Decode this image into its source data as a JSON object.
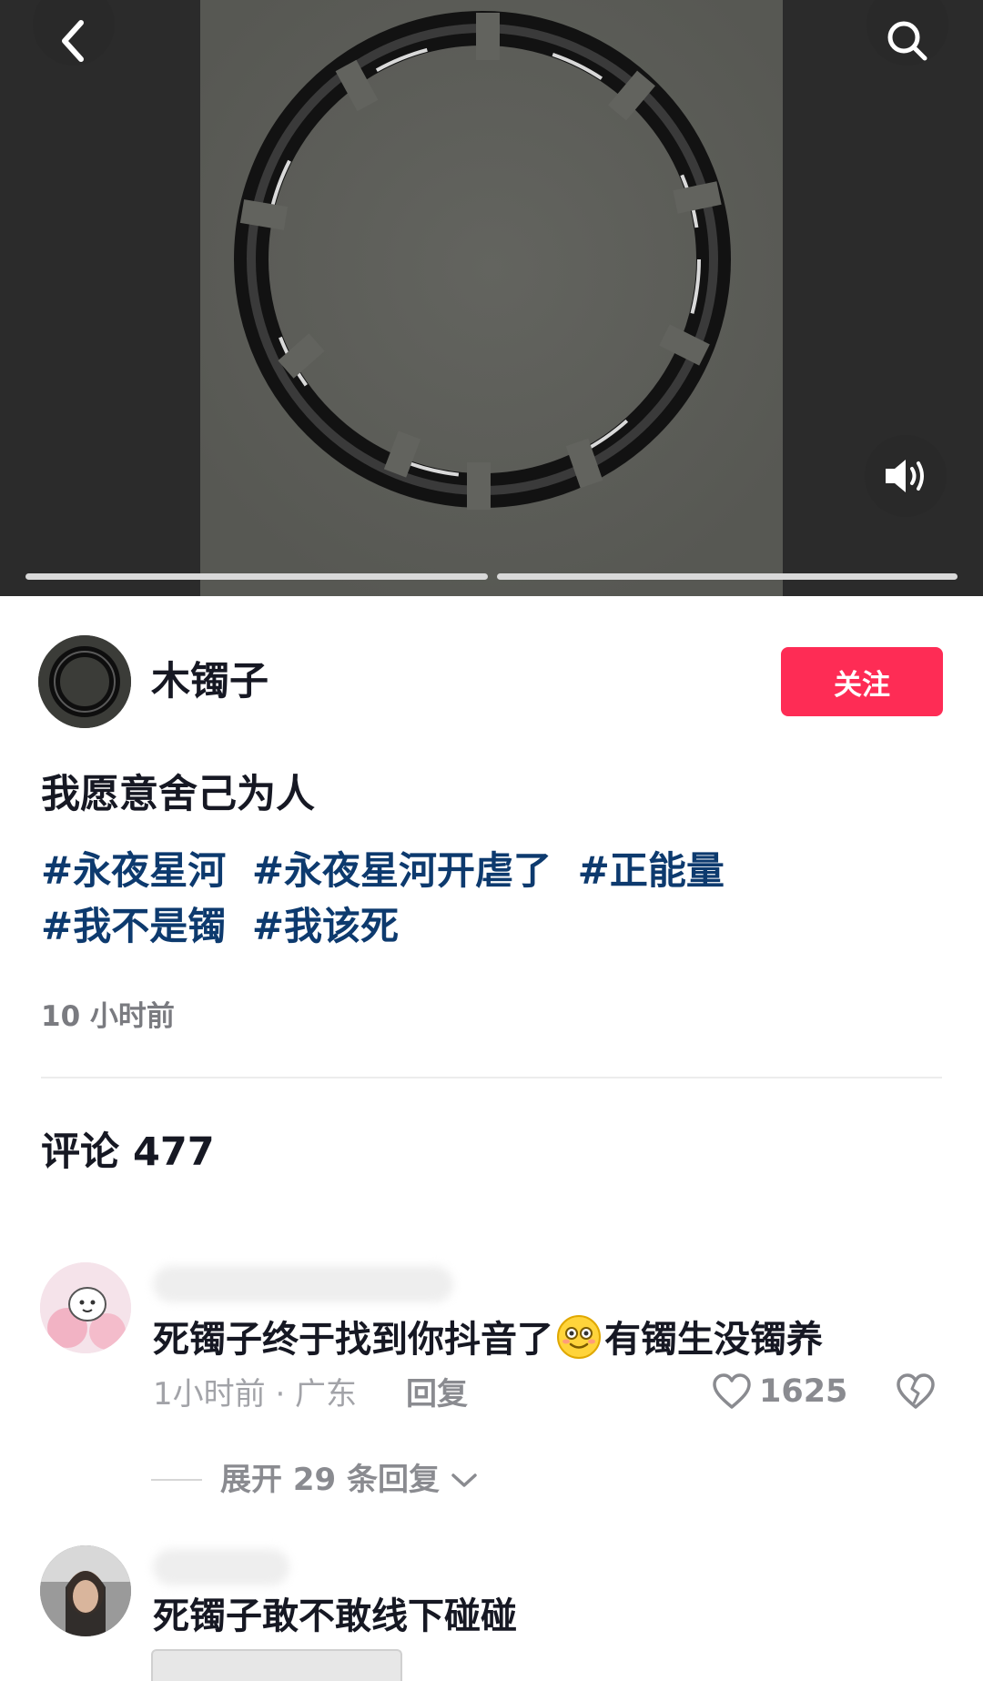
{
  "video": {
    "progress_segments": 2,
    "icons": {
      "back": "chevron-left-icon",
      "search": "search-icon",
      "sound": "speaker-on-icon"
    }
  },
  "author": {
    "name": "木镯子",
    "follow_label": "关注"
  },
  "post": {
    "caption": "我愿意舍己为人",
    "tags": [
      "#永夜星河",
      "#永夜星河开虐了",
      "#正能量",
      "#我不是镯",
      "#我该死"
    ],
    "time": "10 小时前"
  },
  "comments_header": "评论 477",
  "comments": [
    {
      "text_before_emoji": "死镯子终于找到你抖音了",
      "emoji": "smiling-face-emoji",
      "text_after_emoji": "有镯生没镯养",
      "meta": "1小时前 · 广东",
      "reply_label": "回复",
      "likes": "1625",
      "expand_label": "展开 29 条回复"
    },
    {
      "text": "死镯子敢不敢线下碰碰"
    }
  ],
  "colors": {
    "accent": "#fe2c55",
    "hashtag": "#0d3a6e",
    "muted_text": "#8a8b90"
  }
}
